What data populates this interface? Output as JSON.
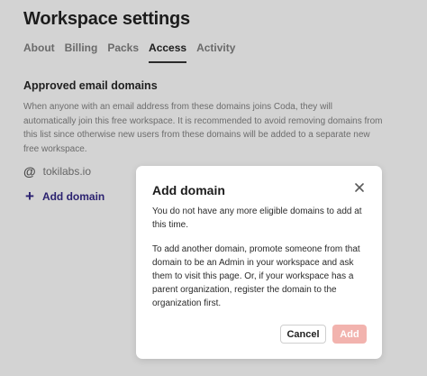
{
  "page": {
    "title": "Workspace settings",
    "tabs": [
      {
        "label": "About"
      },
      {
        "label": "Billing"
      },
      {
        "label": "Packs"
      },
      {
        "label": "Access",
        "active": true
      },
      {
        "label": "Activity"
      }
    ],
    "section_title": "Approved email domains",
    "description": "When anyone with an email address from these domains joins Coda, they will automatically join this free workspace. It is recommended to avoid removing domains from this list since otherwise new users from these domains will be added to a separate new free workspace.",
    "domain": "tokilabs.io",
    "add_domain_label": "Add domain"
  },
  "modal": {
    "title": "Add domain",
    "message": "You do not have any more eligible domains to add at this time.",
    "detail": "To add another domain, promote someone from that domain to be an Admin in your workspace and ask them to visit this page. Or, if your workspace has a parent organization, register the domain to the organization first.",
    "cancel_label": "Cancel",
    "add_label": "Add"
  },
  "colors": {
    "backdrop": "#d3d3d3",
    "accent": "#2b2270",
    "add_button_disabled": "#f2b3ae"
  },
  "icons": {
    "domain": "at-icon",
    "add": "plus-icon",
    "close": "close-icon"
  }
}
